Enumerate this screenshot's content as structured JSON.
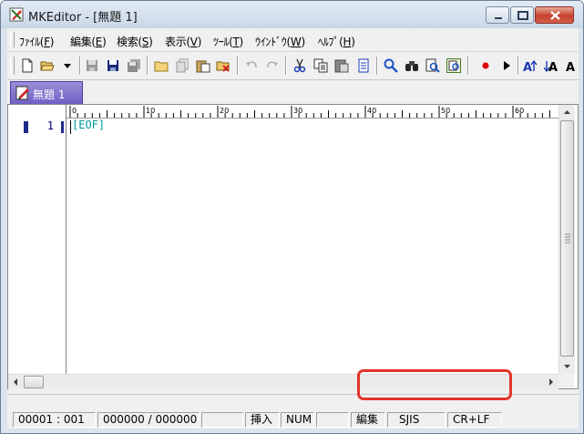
{
  "window": {
    "title": "MKEditor - [無題 1]"
  },
  "menu": {
    "items": [
      {
        "text": "ﾌｧｲﾙ(",
        "key": "F",
        "end": ")"
      },
      {
        "text": "編集(",
        "key": "E",
        "end": ")"
      },
      {
        "text": "検索(",
        "key": "S",
        "end": ")"
      },
      {
        "text": "表示(",
        "key": "V",
        "end": ")"
      },
      {
        "text": "ﾂｰﾙ(",
        "key": "T",
        "end": ")"
      },
      {
        "text": "ｳｲﾝﾄﾞｳ(",
        "key": "W",
        "end": ")"
      },
      {
        "text": "ﾍﾙﾌﾟ(",
        "key": "H",
        "end": ")"
      }
    ]
  },
  "toolbar": {
    "icons": [
      "new-file-icon",
      "open-folder-icon",
      "dropdown-arrow-icon",
      "save-icon",
      "save-as-icon",
      "save-all-icon",
      "folder-icon",
      "copy-file-icon",
      "paste-file-icon",
      "close-file-icon",
      "undo-icon",
      "redo-icon",
      "cut-icon",
      "copy-icon",
      "paste-icon",
      "clipboard-icon",
      "search-icon",
      "binoculars-icon",
      "replace-icon",
      "grep-icon",
      "record-macro-icon",
      "play-macro-icon",
      "font-larger-icon",
      "font-smaller-icon",
      "font-icon"
    ],
    "colors": {
      "record": "#e00000",
      "play": "#000000",
      "search": "#1a56c4"
    }
  },
  "tabs": [
    {
      "label": "無題 1",
      "active": true
    }
  ],
  "editor": {
    "ruler_labels": [
      "0",
      "10",
      "20",
      "30",
      "40",
      "50",
      "60"
    ],
    "line_number": "1",
    "content": "[EOF]",
    "eof_color": "#009999"
  },
  "status": {
    "position": "00001 : 001",
    "byte_count": "000000 / 000000",
    "insert_mode": "挿入",
    "num_lock": "NUM",
    "edit_mode": "編集",
    "encoding": "SJIS",
    "line_ending": "CR+LF"
  },
  "colors": {
    "tab_active": "#7a6bcb",
    "highlight": "#e5342a"
  }
}
